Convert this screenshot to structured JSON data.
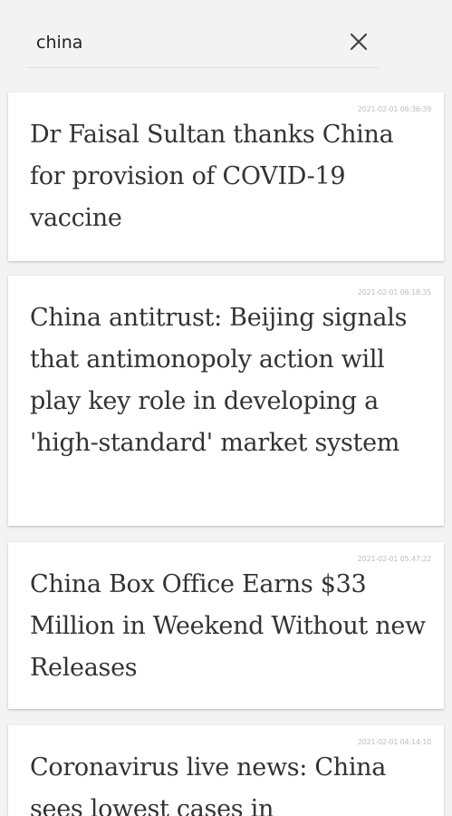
{
  "search": {
    "query": "china"
  },
  "icons": {
    "clear": "close-icon"
  },
  "colors": {
    "background": "#f3f3f3",
    "card": "#ffffff",
    "title_text": "#333333",
    "timestamp_text": "#bdbdbd"
  },
  "articles": [
    {
      "timestamp": "2021-02-01 06:36:39",
      "title": "Dr Faisal Sultan thanks China for provision of COVID-19 vaccine"
    },
    {
      "timestamp": "2021-02-01 06:18:35",
      "title": "China antitrust: Beijing signals that antimonopoly action will play key role in developing a 'high-standard' market system"
    },
    {
      "timestamp": "2021-02-01 05:47:22",
      "title": "China Box Office Earns $33 Million in Weekend Without new Releases"
    },
    {
      "timestamp": "2021-02-01 04:14:10",
      "title": "Coronavirus live news: China sees lowest cases in"
    }
  ]
}
